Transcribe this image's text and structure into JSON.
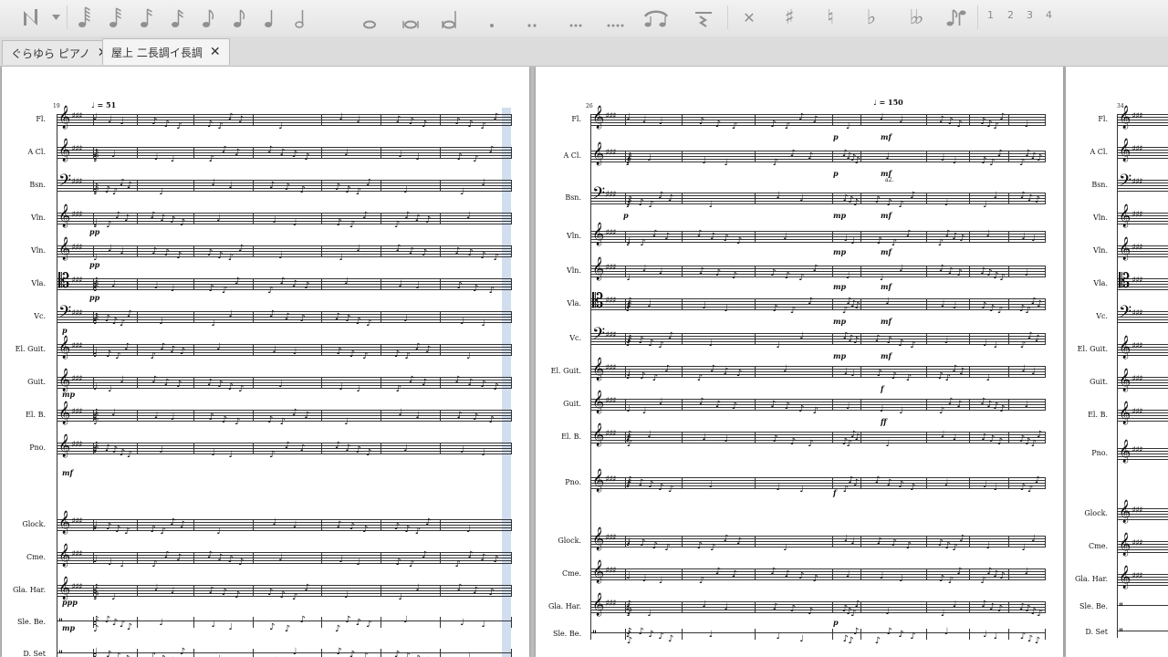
{
  "toolbar": {
    "note_input_icon": "note-input-icon",
    "voices": [
      "1",
      "2",
      "3",
      "4"
    ]
  },
  "tabs": [
    {
      "label": "ぐらゆら ピアノ",
      "active": false
    },
    {
      "label": "屋上 二長調イ長調",
      "active": true
    }
  ],
  "score_pages": [
    {
      "start_measure": "19",
      "tempo": "♩ = 51",
      "instruments": [
        "Fl.",
        "A Cl.",
        "Bsn.",
        "Vln.",
        "Vln.",
        "Vla.",
        "Vc.",
        "El. Guit.",
        "Guit.",
        "El. B.",
        "Pno.",
        "Glock.",
        "Cme.",
        "Gla. Har.",
        "Sle. Be.",
        "D. Set"
      ],
      "dynamics": [
        "pp",
        "pp",
        "pp",
        "p",
        "mp",
        "mf",
        "ppp",
        "mp"
      ]
    },
    {
      "start_measure": "26",
      "tempo": "♩ = 150",
      "instruments": [
        "Fl.",
        "A Cl.",
        "Bsn.",
        "Vln.",
        "Vln.",
        "Vla.",
        "Vc.",
        "El. Guit.",
        "Guit.",
        "El. B.",
        "Pno.",
        "Glock.",
        "Cme.",
        "Gla. Har.",
        "Sle. Be."
      ],
      "dynamics": [
        "p",
        "mf",
        "p",
        "mf",
        "p",
        "mp",
        "mf",
        "mp",
        "mf",
        "mp",
        "mf",
        "mp",
        "mf",
        "mp",
        "mf",
        "f",
        "ff",
        "f",
        "p"
      ],
      "annotation": "a2."
    },
    {
      "start_measure": "34",
      "instruments": [
        "Fl.",
        "A Cl.",
        "Bsn.",
        "Vln.",
        "Vln.",
        "Vla.",
        "Vc.",
        "El. Guit.",
        "Guit.",
        "El. B.",
        "Pno.",
        "Glock.",
        "Cme.",
        "Gla. Har.",
        "Sle. Be.",
        "D. Set"
      ]
    }
  ],
  "colors": {
    "selection": "#a8c4e4",
    "toolbar_icon": "#8f8f8f",
    "canvas": "#bfbfbf"
  }
}
